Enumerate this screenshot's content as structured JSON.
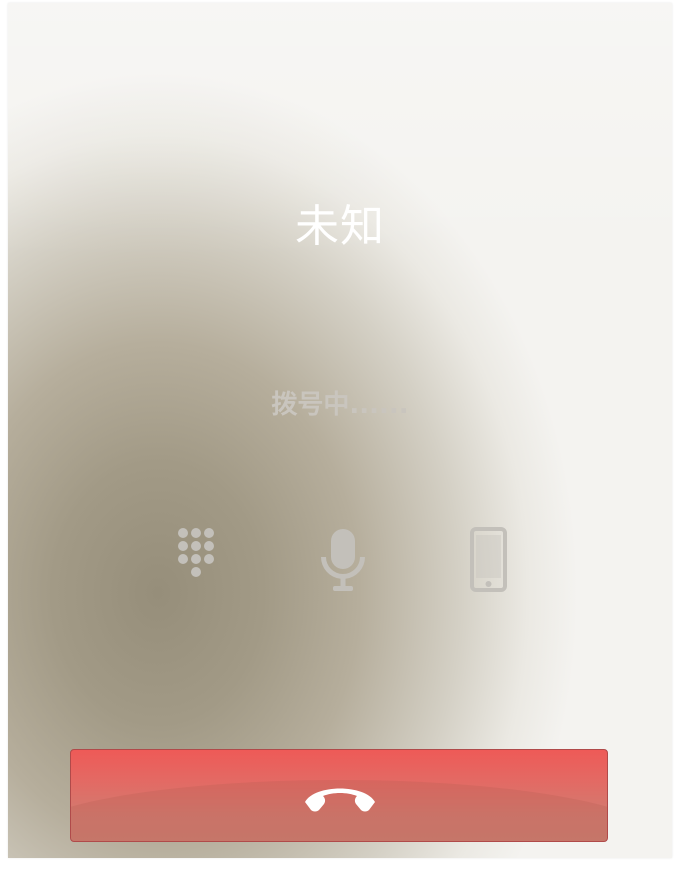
{
  "call": {
    "caller_name": "未知",
    "status": "拨号中......"
  },
  "controls": [
    {
      "name": "keypad",
      "icon": "dialpad-icon"
    },
    {
      "name": "mute",
      "icon": "microphone-icon"
    },
    {
      "name": "speaker",
      "icon": "phone-device-icon"
    }
  ],
  "end_call": {
    "icon": "hang-up-icon",
    "color": "#e8605b"
  },
  "colors": {
    "icon_gray": "#c3c0ba",
    "end_call_red": "#e8605b",
    "caller_name": "#ffffff"
  }
}
